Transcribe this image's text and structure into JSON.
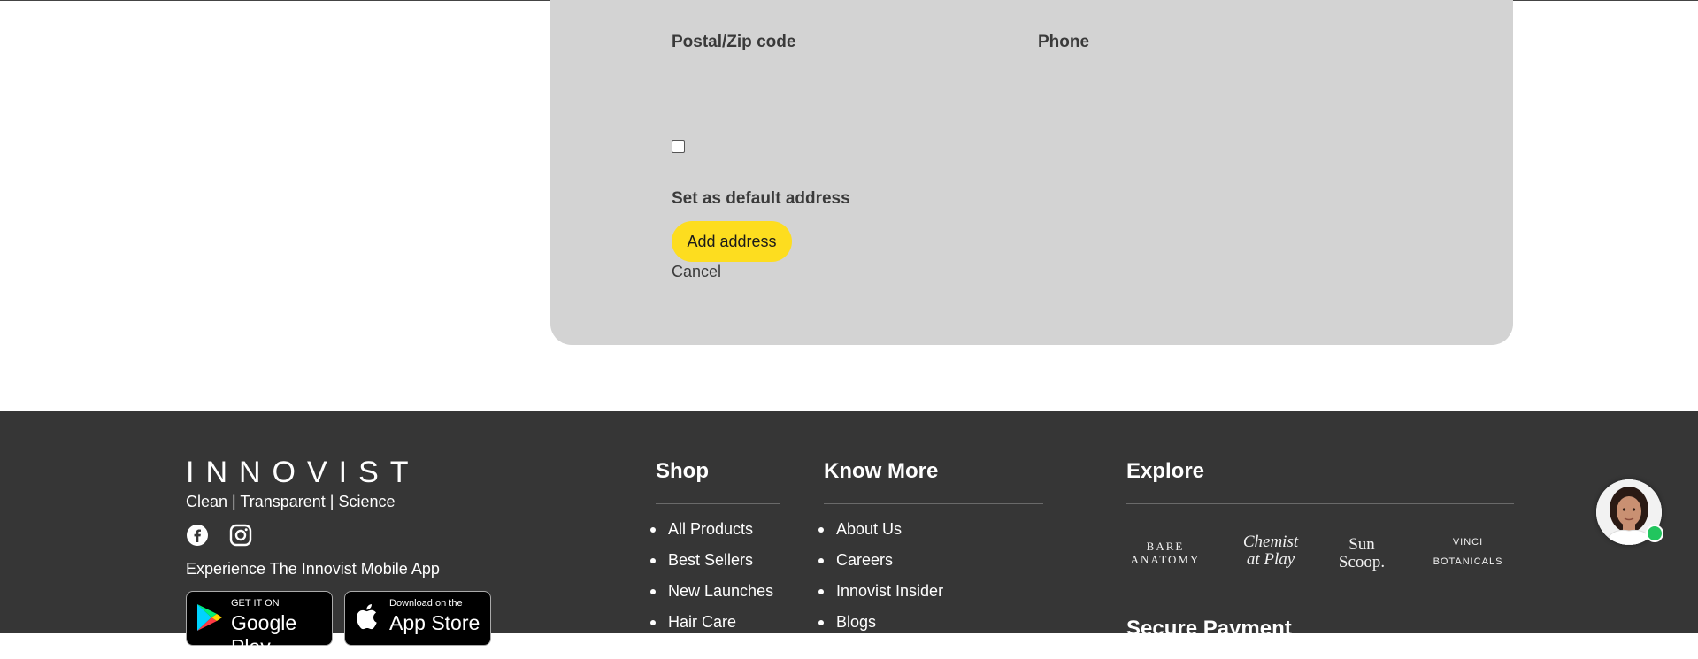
{
  "form": {
    "postal_label": "Postal/Zip code",
    "phone_label": "Phone",
    "default_label": "Set as default address",
    "default_checked": false,
    "add_button": "Add address",
    "cancel_link": "Cancel"
  },
  "footer": {
    "logo": "INNOVIST",
    "tagline": "Clean | Transparent | Science",
    "social": [
      "facebook-icon",
      "instagram-icon"
    ],
    "mobile_app": "Experience The Innovist Mobile App",
    "google_play": {
      "small": "GET IT ON",
      "big": "Google Play"
    },
    "app_store": {
      "small": "Download on the",
      "big": "App Store"
    },
    "shop": {
      "title": "Shop",
      "links": [
        "All Products",
        "Best Sellers",
        "New Launches",
        "Hair Care"
      ]
    },
    "know_more": {
      "title": "Know More",
      "links": [
        "About Us",
        "Careers",
        "Innovist Insider",
        "Blogs"
      ]
    },
    "explore": {
      "title": "Explore",
      "brands": [
        "BARE ANATOMY",
        "Chemist at Play",
        "Sun Scoop.",
        "VINCI BOTANICALS"
      ]
    },
    "secure_payment": "Secure Payment"
  },
  "colors": {
    "panel_bg": "#d3d3d3",
    "accent_yellow": "#fddd1f",
    "footer_bg": "#363636",
    "online": "#22c55e"
  }
}
